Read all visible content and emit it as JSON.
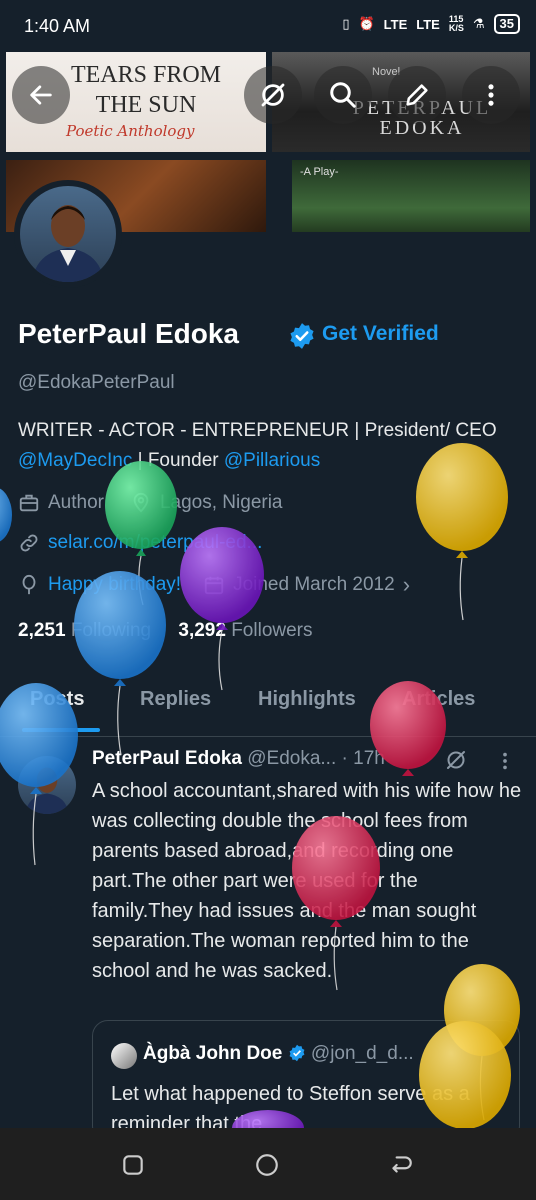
{
  "status_bar": {
    "time": "1:40 AM",
    "network1": "LTE",
    "network2": "LTE",
    "speed": "115\nK/S",
    "battery": "35"
  },
  "banner": {
    "tile1_title": "TEARS FROM THE SUN",
    "tile1_subtitle": "Poetic Anthology",
    "tile2_kicker": "Novel",
    "tile2_title": "PETERPAUL EDOKA",
    "tile4_kicker": "-A Play-"
  },
  "header": {
    "back_icon": "back-arrow-icon",
    "actions": [
      "grok-icon",
      "search-icon",
      "edit-icon",
      "more-vertical-icon"
    ]
  },
  "profile": {
    "name": "PeterPaul Edoka",
    "get_verified": "Get Verified",
    "handle": "@EdokaPeterPaul",
    "bio_part1": "WRITER - ACTOR - ENTREPRENEUR | President/ CEO ",
    "bio_link1": "@MayDecInc",
    "bio_part2": " | Founder ",
    "bio_link2": "@Pillarious",
    "occupation": "Author",
    "location": "Lagos, Nigeria",
    "website": "selar.co/m/peterpaul-ed...",
    "birthday": "Happy birthday!",
    "joined": "Joined March 2012",
    "following_count": "2,251",
    "following_label": "Following",
    "followers_count": "3,292",
    "followers_label": "Followers"
  },
  "tabs": [
    "Posts",
    "Replies",
    "Highlights",
    "Articles"
  ],
  "tweet": {
    "author": "PeterPaul Edoka",
    "handle": "@Edoka...",
    "time": "· 17h",
    "text": "A school accountant,shared with his wife how he was collecting double the school fees from parents based abroad,and recording one part.The other part were used for the family.They had issues and the man sought separation.The woman reported him to the school and he was sacked.",
    "quote": {
      "author": "Àgbà John Doe",
      "handle": "@jon_d_d...",
      "text": "Let what happened to Steffon serve as a reminder that the"
    }
  },
  "colors": {
    "background": "#15202b",
    "accent": "#1d9bf0",
    "muted": "#8b98a5",
    "balloon_green": "#2ecc71",
    "balloon_purple": "#8e2be2",
    "balloon_yellow": "#f1c40f",
    "balloon_blue": "#3498db",
    "balloon_red": "#e0245e"
  },
  "navbar": [
    "recents-icon",
    "home-icon",
    "back-icon"
  ]
}
